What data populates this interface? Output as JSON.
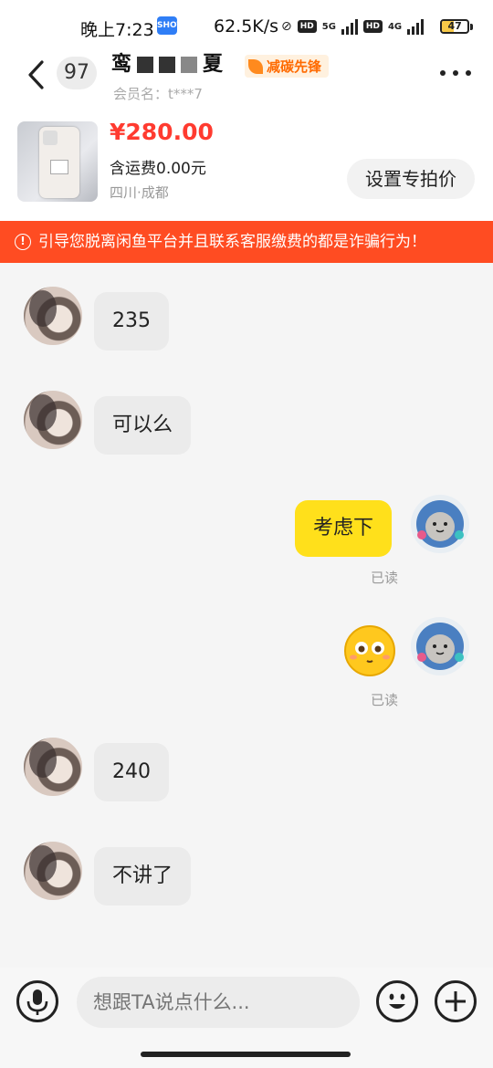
{
  "status_bar": {
    "time": "晚上7:23",
    "app_icon_label": "SHOT",
    "speed": "62.5K/s",
    "hd1": "HD",
    "net1": "5G",
    "hd2": "HD",
    "net2": "4G",
    "battery": "47",
    "battery_level": 0.47
  },
  "header": {
    "unread_count": "97",
    "title_visible_char": "鸾",
    "title_end_char": "夏",
    "badge": "减碳先锋",
    "subtitle": "会员名：t***7"
  },
  "product": {
    "price": "¥280.00",
    "shipping": "含运费0.00元",
    "location": "四川·成都",
    "set_price_button": "设置专拍价"
  },
  "warning": {
    "icon": "!",
    "text": "引导您脱离闲鱼平台并且联系客服缴费的都是诈骗行为！"
  },
  "messages": [
    {
      "side": "in",
      "text": "235"
    },
    {
      "side": "in",
      "text": "可以么"
    },
    {
      "side": "out",
      "text": "考虑下",
      "read": "已读"
    },
    {
      "side": "out",
      "emoji": "emoji-face",
      "read": "已读"
    },
    {
      "side": "in",
      "text": "240"
    },
    {
      "side": "in",
      "text": "不讲了"
    }
  ],
  "input": {
    "placeholder": "想跟TA说点什么..."
  },
  "colors": {
    "warning_bg": "#ff4c22",
    "price": "#ff3b30",
    "out_bubble": "#ffe01b",
    "badge_text": "#ff6a00"
  }
}
